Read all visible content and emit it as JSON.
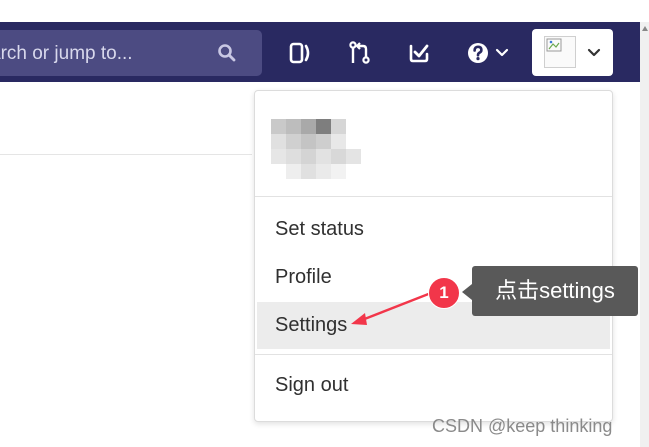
{
  "search": {
    "placeholder": "arch or jump to..."
  },
  "navbar": {
    "icons": [
      "search-icon",
      "issues-icon",
      "merge-request-icon",
      "todo-check-icon",
      "help-icon",
      "chevron-down-icon"
    ]
  },
  "user_menu": {
    "items": [
      {
        "label": "Set status"
      },
      {
        "label": "Profile"
      },
      {
        "label": "Settings"
      },
      {
        "label": "Sign out"
      }
    ]
  },
  "annotation": {
    "step": "1",
    "text": "点击settings"
  },
  "watermark": "CSDN @keep   thinking",
  "colors": {
    "navbar": "#292961",
    "search_bg": "#4c4b82",
    "badge": "#f2364a",
    "tooltip": "#595959",
    "active_item": "#ececec"
  }
}
